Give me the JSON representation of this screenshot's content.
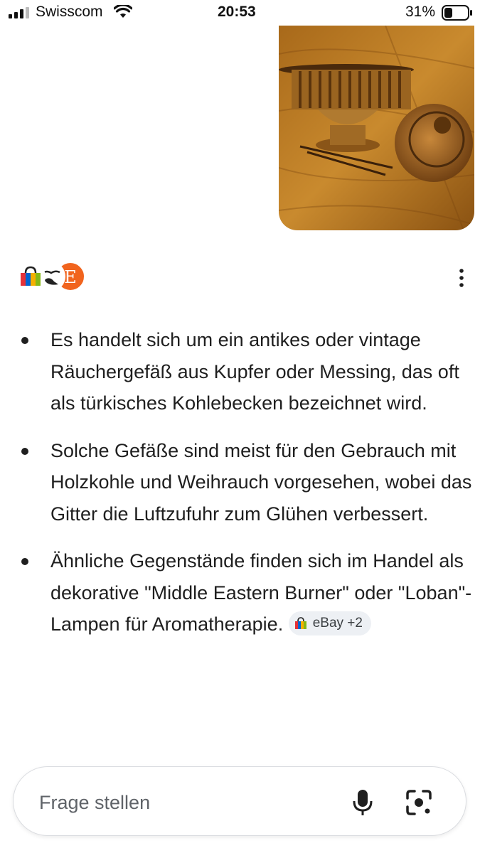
{
  "status_bar": {
    "carrier": "Swisscom",
    "time": "20:53",
    "battery": "31%"
  },
  "uploaded_image": {
    "subject": "copper brazier photo"
  },
  "sources": {
    "icons": [
      "ebay-bag-icon",
      "birds-logo-icon",
      "etsy-e-icon"
    ]
  },
  "answer": {
    "bullets": [
      "Es handelt sich um ein antikes oder vintage Räuchergefäß aus Kupfer oder Messing, das oft als türkisches Kohlebecken bezeichnet wird.",
      "Solche Gefäße sind meist für den Gebrauch mit Holzkohle und Weihrauch vorgesehen, wobei das Gitter die Luftzufuhr zum Glühen verbessert.",
      "Ähnliche Gegenstände finden sich im Handel als dekorative \"Middle Eastern Burner\" oder \"Loban\"-Lampen für Aromatherapie."
    ],
    "source_chip": "eBay +2"
  },
  "input_bar": {
    "placeholder": "Frage stellen"
  },
  "colors": {
    "chip_bg": "#edf0f4",
    "text": "#1f1f1f",
    "placeholder": "#5f6368"
  }
}
